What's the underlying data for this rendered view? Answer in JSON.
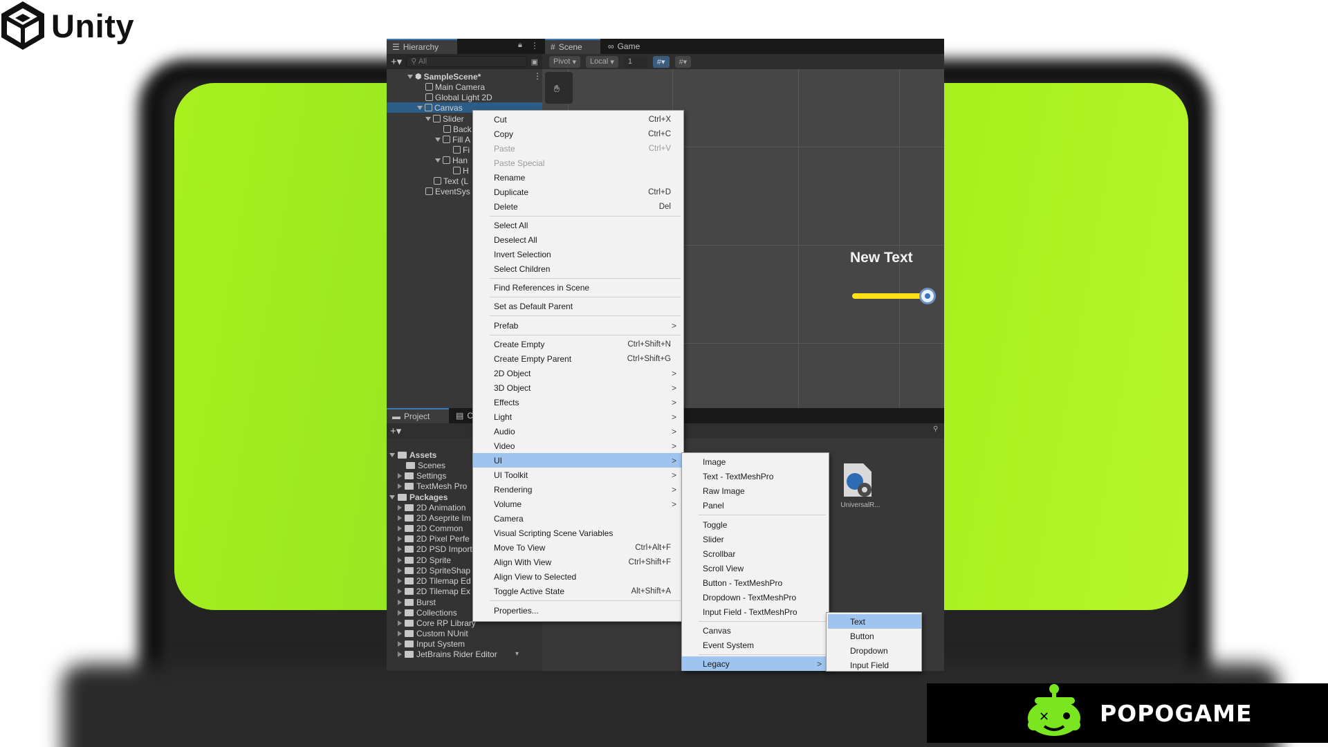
{
  "brand": {
    "unity_wordmark": "Unity",
    "popogame": "POPOGAME",
    "accent": "#a6ef1b"
  },
  "editor": {
    "hierarchy_tab": "Hierarchy",
    "scene_tab": "Scene",
    "game_tab": "Game",
    "search_placeholder": "All",
    "toolbar": {
      "pivot": "Pivot",
      "local": "Local",
      "grid_value": "1"
    },
    "tree": [
      {
        "label": "SampleScene*"
      },
      {
        "label": "Main Camera"
      },
      {
        "label": "Global Light 2D"
      },
      {
        "label": "Canvas"
      },
      {
        "label": "Slider"
      },
      {
        "label": "Back"
      },
      {
        "label": "Fill A"
      },
      {
        "label": "Fi"
      },
      {
        "label": "Han"
      },
      {
        "label": "H"
      },
      {
        "label": "Text (L"
      },
      {
        "label": "EventSys"
      }
    ],
    "scene": {
      "text": "New Text"
    },
    "project_tab": "Project",
    "console_tab": "C",
    "project_tree": [
      {
        "label": "Assets"
      },
      {
        "label": "Scenes"
      },
      {
        "label": "Settings"
      },
      {
        "label": "TextMesh Pro"
      },
      {
        "label": "Packages"
      },
      {
        "label": "2D Animation"
      },
      {
        "label": "2D Aseprite Im"
      },
      {
        "label": "2D Common"
      },
      {
        "label": "2D Pixel Perfe"
      },
      {
        "label": "2D PSD Import"
      },
      {
        "label": "2D Sprite"
      },
      {
        "label": "2D SpriteShap"
      },
      {
        "label": "2D Tilemap Ed"
      },
      {
        "label": "2D Tilemap Ex"
      },
      {
        "label": "Burst"
      },
      {
        "label": "Collections"
      },
      {
        "label": "Core RP Library"
      },
      {
        "label": "Custom NUnit"
      },
      {
        "label": "Input System"
      },
      {
        "label": "JetBrains Rider Editor"
      }
    ],
    "asset_label": "UniversalR..."
  },
  "context_menu": [
    {
      "label": "Cut",
      "shortcut": "Ctrl+X"
    },
    {
      "label": "Copy",
      "shortcut": "Ctrl+C"
    },
    {
      "label": "Paste",
      "shortcut": "Ctrl+V",
      "disabled": true
    },
    {
      "label": "Paste Special",
      "disabled": true
    },
    {
      "label": "Rename"
    },
    {
      "label": "Duplicate",
      "shortcut": "Ctrl+D"
    },
    {
      "label": "Delete",
      "shortcut": "Del"
    },
    {
      "label": "Select All"
    },
    {
      "label": "Deselect All"
    },
    {
      "label": "Invert Selection"
    },
    {
      "label": "Select Children"
    },
    {
      "label": "Find References in Scene"
    },
    {
      "label": "Set as Default Parent"
    },
    {
      "label": "Prefab",
      "chevron": ">"
    },
    {
      "label": "Create Empty",
      "shortcut": "Ctrl+Shift+N"
    },
    {
      "label": "Create Empty Parent",
      "shortcut": "Ctrl+Shift+G"
    },
    {
      "label": "2D Object",
      "chevron": ">"
    },
    {
      "label": "3D Object",
      "chevron": ">"
    },
    {
      "label": "Effects",
      "chevron": ">"
    },
    {
      "label": "Light",
      "chevron": ">"
    },
    {
      "label": "Audio",
      "chevron": ">"
    },
    {
      "label": "Video",
      "chevron": ">"
    },
    {
      "label": "UI",
      "chevron": ">",
      "highlighted": true
    },
    {
      "label": "UI Toolkit",
      "chevron": ">"
    },
    {
      "label": "Rendering",
      "chevron": ">"
    },
    {
      "label": "Volume",
      "chevron": ">"
    },
    {
      "label": "Camera"
    },
    {
      "label": "Visual Scripting Scene Variables"
    },
    {
      "label": "Move To View",
      "shortcut": "Ctrl+Alt+F"
    },
    {
      "label": "Align With View",
      "shortcut": "Ctrl+Shift+F"
    },
    {
      "label": "Align View to Selected"
    },
    {
      "label": "Toggle Active State",
      "shortcut": "Alt+Shift+A"
    },
    {
      "label": "Properties..."
    }
  ],
  "ui_submenu": [
    {
      "label": "Image"
    },
    {
      "label": "Text - TextMeshPro"
    },
    {
      "label": "Raw Image"
    },
    {
      "label": "Panel"
    },
    {
      "label": "Toggle"
    },
    {
      "label": "Slider"
    },
    {
      "label": "Scrollbar"
    },
    {
      "label": "Scroll View"
    },
    {
      "label": "Button - TextMeshPro"
    },
    {
      "label": "Dropdown - TextMeshPro"
    },
    {
      "label": "Input Field - TextMeshPro"
    },
    {
      "label": "Canvas"
    },
    {
      "label": "Event System"
    },
    {
      "label": "Legacy",
      "chevron": ">",
      "highlighted": true
    }
  ],
  "legacy_submenu": [
    {
      "label": "Text",
      "highlighted": true
    },
    {
      "label": "Button"
    },
    {
      "label": "Dropdown"
    },
    {
      "label": "Input Field"
    }
  ]
}
